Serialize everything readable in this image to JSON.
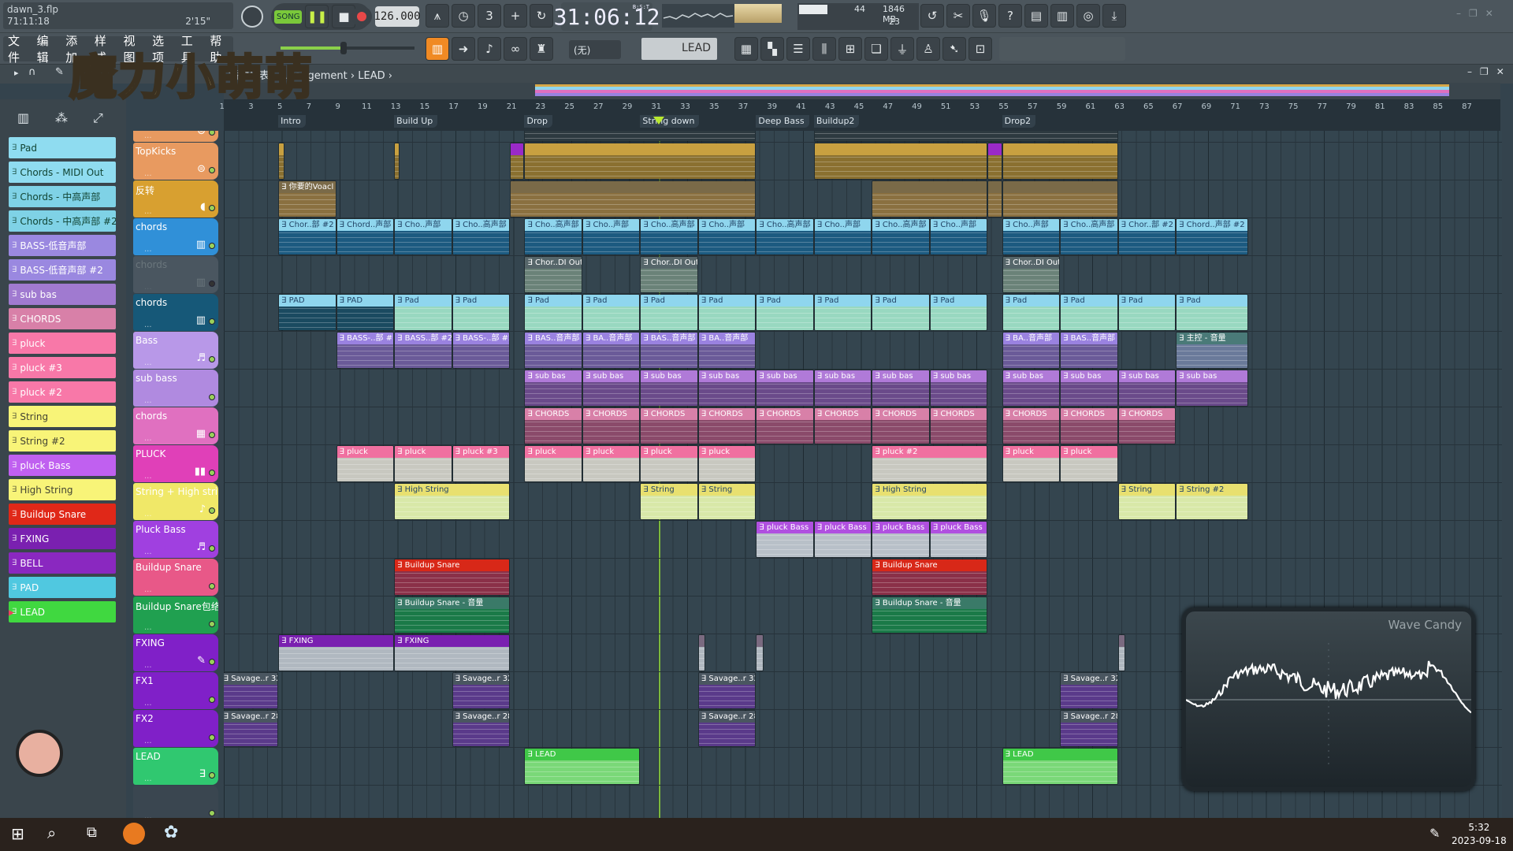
{
  "window": {
    "file": "dawn_3.flp",
    "position": "71:11:18",
    "length": "2'15\"",
    "watermark": "魔力小萌萌"
  },
  "menu": [
    "文件",
    "编辑",
    "添加",
    "样式",
    "视图",
    "选项",
    "工具",
    "帮助"
  ],
  "transport": {
    "mode": "SONG",
    "tempo": "126.000",
    "time": "31:06:12",
    "time_format": "B:S:T",
    "cpu": "44",
    "memory": "1846 MB",
    "polyphony": "23",
    "pattern_selector": "(无)",
    "current_pattern": "LEAD"
  },
  "breadcrumb": {
    "path": "播放列表 - Arrangement",
    "current": "LEAD"
  },
  "colors": {
    "accent": "#f08a24",
    "playhead": "#8fd63a"
  },
  "ruler": {
    "first_bar": 1,
    "last_bar": 87,
    "step": 2,
    "playhead_bar": 31.3
  },
  "markers": [
    {
      "label": "Intro",
      "bar": 5
    },
    {
      "label": "Build Up",
      "bar": 13
    },
    {
      "label": "Drop",
      "bar": 22
    },
    {
      "label": "String down",
      "bar": 30
    },
    {
      "label": "Deep Bass",
      "bar": 38
    },
    {
      "label": "Buildup2",
      "bar": 42
    },
    {
      "label": "Drop2",
      "bar": 55
    }
  ],
  "patterns": [
    {
      "label": "Pad",
      "color": "#8fdcf0",
      "text": "#143"
    },
    {
      "label": "Chords - MIDI Out",
      "color": "#8fdcf0",
      "text": "#143"
    },
    {
      "label": "Chords - 中高声部",
      "color": "#7fd2e6",
      "text": "#143"
    },
    {
      "label": "Chords - 中高声部 #2",
      "color": "#7fd2e6",
      "text": "#143"
    },
    {
      "label": "BASS-低音声部",
      "color": "#9a88e0",
      "text": "#fff"
    },
    {
      "label": "BASS-低音声部 #2",
      "color": "#9a88e0",
      "text": "#fff"
    },
    {
      "label": "sub bas",
      "color": "#a07ad0",
      "text": "#fff"
    },
    {
      "label": "CHORDS",
      "color": "#d880a8",
      "text": "#fff"
    },
    {
      "label": "pluck",
      "color": "#f878a8",
      "text": "#fff"
    },
    {
      "label": "pluck #3",
      "color": "#f878a8",
      "text": "#fff"
    },
    {
      "label": "pluck #2",
      "color": "#f878a8",
      "text": "#fff"
    },
    {
      "label": "String",
      "color": "#f8f478",
      "text": "#443"
    },
    {
      "label": "String #2",
      "color": "#f8f478",
      "text": "#443"
    },
    {
      "label": "pluck Bass",
      "color": "#c060f0",
      "text": "#fff"
    },
    {
      "label": "High String",
      "color": "#f8f478",
      "text": "#443"
    },
    {
      "label": "Buildup Snare",
      "color": "#e02818",
      "text": "#fff"
    },
    {
      "label": "FXING",
      "color": "#7a20b0",
      "text": "#fff"
    },
    {
      "label": "BELL",
      "color": "#8a28c0",
      "text": "#fff"
    },
    {
      "label": "PAD",
      "color": "#50c8e0",
      "text": "#fff"
    },
    {
      "label": "LEAD",
      "color": "#40d840",
      "text": "#fff",
      "selected": true
    }
  ],
  "tracks": [
    {
      "name": "",
      "color": "#e89a60",
      "icon": "drum-icon",
      "head": "#d8a848",
      "body": "#2d3a40",
      "clips": [
        {
          "s": 22,
          "l": 16,
          "t": ""
        },
        {
          "s": 42,
          "l": 21,
          "t": ""
        }
      ]
    },
    {
      "name": "TopKicks",
      "color": "#e89a60",
      "icon": "drum-icon",
      "head": "#c8a040",
      "body": "#8a7030",
      "clips": [
        {
          "s": 5,
          "l": 0.4,
          "t": ""
        },
        {
          "s": 13,
          "l": 0.4,
          "t": ""
        },
        {
          "s": 21,
          "l": 1,
          "t": "",
          "head": "#9a2ac8"
        },
        {
          "s": 22,
          "l": 16,
          "t": ""
        },
        {
          "s": 42,
          "l": 12,
          "t": ""
        },
        {
          "s": 54,
          "l": 1,
          "t": "",
          "head": "#9a2ac8"
        },
        {
          "s": 55,
          "l": 8,
          "t": ""
        }
      ]
    },
    {
      "name": "反转",
      "color": "#d8a030",
      "icon": "audio-icon",
      "head": "#7a6a48",
      "body": "#8a7040",
      "clips": [
        {
          "s": 5,
          "l": 4,
          "t": "你要的Voacl"
        },
        {
          "s": 21,
          "l": 17,
          "t": ""
        },
        {
          "s": 46,
          "l": 8,
          "t": ""
        },
        {
          "s": 54,
          "l": 1,
          "t": ""
        },
        {
          "s": 55,
          "l": 8,
          "t": ""
        }
      ]
    },
    {
      "name": "chords",
      "color": "#3090d8",
      "icon": "piano-icon",
      "head": "#8fd6ee",
      "body": "#1c5a80",
      "clips": [
        {
          "s": 5,
          "l": 4,
          "t": "Chor..部 #2"
        },
        {
          "s": 9,
          "l": 4,
          "t": "Chord..声部"
        },
        {
          "s": 13,
          "l": 4,
          "t": "Cho..声部"
        },
        {
          "s": 17,
          "l": 4,
          "t": "Cho..高声部"
        },
        {
          "s": 22,
          "l": 4,
          "t": "Cho..高声部"
        },
        {
          "s": 26,
          "l": 4,
          "t": "Cho..声部"
        },
        {
          "s": 30,
          "l": 4,
          "t": "Cho..高声部"
        },
        {
          "s": 34,
          "l": 4,
          "t": "Cho..声部"
        },
        {
          "s": 38,
          "l": 4,
          "t": "Cho..高声部"
        },
        {
          "s": 42,
          "l": 4,
          "t": "Cho..声部"
        },
        {
          "s": 46,
          "l": 4,
          "t": "Cho..高声部"
        },
        {
          "s": 50,
          "l": 4,
          "t": "Cho..声部"
        },
        {
          "s": 55,
          "l": 4,
          "t": "Cho..声部"
        },
        {
          "s": 59,
          "l": 4,
          "t": "Cho..高声部"
        },
        {
          "s": 63,
          "l": 4,
          "t": "Chor..部 #2"
        },
        {
          "s": 67,
          "l": 5,
          "t": "Chord..声部 #2"
        }
      ]
    },
    {
      "name": "chords",
      "color": "#4a5660",
      "icon": "piano-icon",
      "muted": true,
      "head": "#56666a",
      "body": "#6a8278",
      "clips": [
        {
          "s": 22,
          "l": 4,
          "t": "Chor..DI Out"
        },
        {
          "s": 30,
          "l": 4,
          "t": "Chor..DI Out"
        },
        {
          "s": 55,
          "l": 4,
          "t": "Chor..DI Out"
        }
      ]
    },
    {
      "name": "chords",
      "color": "#165878",
      "icon": "piano-icon",
      "head": "#8fd6ee",
      "body": "#98d8c0",
      "clips": [
        {
          "s": 5,
          "l": 4,
          "t": "PAD",
          "body": "#1a4a60"
        },
        {
          "s": 9,
          "l": 4,
          "t": "PAD",
          "body": "#1a4a60"
        },
        {
          "s": 13,
          "l": 4,
          "t": "Pad"
        },
        {
          "s": 17,
          "l": 4,
          "t": "Pad"
        },
        {
          "s": 22,
          "l": 4,
          "t": "Pad"
        },
        {
          "s": 26,
          "l": 4,
          "t": "Pad"
        },
        {
          "s": 30,
          "l": 4,
          "t": "Pad"
        },
        {
          "s": 34,
          "l": 4,
          "t": "Pad"
        },
        {
          "s": 38,
          "l": 4,
          "t": "Pad"
        },
        {
          "s": 42,
          "l": 4,
          "t": "Pad"
        },
        {
          "s": 46,
          "l": 4,
          "t": "Pad"
        },
        {
          "s": 50,
          "l": 4,
          "t": "Pad"
        },
        {
          "s": 55,
          "l": 4,
          "t": "Pad"
        },
        {
          "s": 59,
          "l": 4,
          "t": "Pad"
        },
        {
          "s": 63,
          "l": 4,
          "t": "Pad"
        },
        {
          "s": 67,
          "l": 5,
          "t": "Pad"
        }
      ]
    },
    {
      "name": "Bass",
      "color": "#b898e8",
      "icon": "guitar-icon",
      "head": "#9a82e0",
      "body": "#6a5a98",
      "clips": [
        {
          "s": 9,
          "l": 4,
          "t": "BASS-..部 #2"
        },
        {
          "s": 13,
          "l": 4,
          "t": "BASS..部 #2"
        },
        {
          "s": 17,
          "l": 4,
          "t": "BASS-..部 #2"
        },
        {
          "s": 22,
          "l": 4,
          "t": "BAS..音声部"
        },
        {
          "s": 26,
          "l": 4,
          "t": "BA..音声部"
        },
        {
          "s": 30,
          "l": 4,
          "t": "BAS..音声部"
        },
        {
          "s": 34,
          "l": 4,
          "t": "BA..音声部"
        },
        {
          "s": 55,
          "l": 4,
          "t": "BA..音声部"
        },
        {
          "s": 59,
          "l": 4,
          "t": "BAS..音声部"
        },
        {
          "s": 67,
          "l": 5,
          "t": "主控 - 音量",
          "head": "#4a7a78",
          "body": "#6a7a9a"
        }
      ]
    },
    {
      "name": "sub bass",
      "color": "#b08ae0",
      "icon": "",
      "head": "#b07ad8",
      "body": "#6a4a8a",
      "clips": [
        {
          "s": 22,
          "l": 4,
          "t": "sub bas"
        },
        {
          "s": 26,
          "l": 4,
          "t": "sub bas"
        },
        {
          "s": 30,
          "l": 4,
          "t": "sub bas"
        },
        {
          "s": 34,
          "l": 4,
          "t": "sub bas"
        },
        {
          "s": 38,
          "l": 4,
          "t": "sub bas"
        },
        {
          "s": 42,
          "l": 4,
          "t": "sub bas"
        },
        {
          "s": 46,
          "l": 4,
          "t": "sub bas"
        },
        {
          "s": 50,
          "l": 4,
          "t": "sub bas"
        },
        {
          "s": 55,
          "l": 4,
          "t": "sub bas"
        },
        {
          "s": 59,
          "l": 4,
          "t": "sub bas"
        },
        {
          "s": 63,
          "l": 4,
          "t": "sub bas"
        },
        {
          "s": 67,
          "l": 5,
          "t": "sub bas"
        }
      ]
    },
    {
      "name": "chords",
      "color": "#e070c0",
      "icon": "keys-icon",
      "head": "#d880a8",
      "body": "#8a4a6a",
      "clips": [
        {
          "s": 22,
          "l": 4,
          "t": "CHORDS"
        },
        {
          "s": 26,
          "l": 4,
          "t": "CHORDS"
        },
        {
          "s": 30,
          "l": 4,
          "t": "CHORDS"
        },
        {
          "s": 34,
          "l": 4,
          "t": "CHORDS"
        },
        {
          "s": 38,
          "l": 4,
          "t": "CHORDS"
        },
        {
          "s": 42,
          "l": 4,
          "t": "CHORDS"
        },
        {
          "s": 46,
          "l": 4,
          "t": "CHORDS"
        },
        {
          "s": 50,
          "l": 4,
          "t": "CHORDS"
        },
        {
          "s": 55,
          "l": 4,
          "t": "CHORDS"
        },
        {
          "s": 59,
          "l": 4,
          "t": "CHORDS"
        },
        {
          "s": 63,
          "l": 4,
          "t": "CHORDS"
        }
      ]
    },
    {
      "name": "PLUCK",
      "color": "#e040b8",
      "icon": "xylophone-icon",
      "head": "#f070a0",
      "body": "#c8c8c0",
      "clips": [
        {
          "s": 9,
          "l": 4,
          "t": "pluck"
        },
        {
          "s": 13,
          "l": 4,
          "t": "pluck"
        },
        {
          "s": 17,
          "l": 4,
          "t": "pluck #3"
        },
        {
          "s": 22,
          "l": 4,
          "t": "pluck"
        },
        {
          "s": 26,
          "l": 4,
          "t": "pluck"
        },
        {
          "s": 30,
          "l": 4,
          "t": "pluck"
        },
        {
          "s": 34,
          "l": 4,
          "t": "pluck"
        },
        {
          "s": 46,
          "l": 8,
          "t": "pluck #2"
        },
        {
          "s": 55,
          "l": 4,
          "t": "pluck"
        },
        {
          "s": 59,
          "l": 4,
          "t": "pluck"
        }
      ]
    },
    {
      "name": "String + High string",
      "color": "#f0e868",
      "icon": "violin-icon",
      "head": "#e8e070",
      "body": "#d8e8a8",
      "clips": [
        {
          "s": 13,
          "l": 8,
          "t": "High String"
        },
        {
          "s": 30,
          "l": 4,
          "t": "String"
        },
        {
          "s": 34,
          "l": 4,
          "t": "String"
        },
        {
          "s": 46,
          "l": 8,
          "t": "High String"
        },
        {
          "s": 63,
          "l": 4,
          "t": "String"
        },
        {
          "s": 67,
          "l": 5,
          "t": "String #2"
        }
      ]
    },
    {
      "name": "Pluck Bass",
      "color": "#a040e0",
      "icon": "guitar-icon",
      "head": "#b050e0",
      "body": "#b8c0c8",
      "clips": [
        {
          "s": 38,
          "l": 4,
          "t": "pluck Bass"
        },
        {
          "s": 42,
          "l": 4,
          "t": "pluck Bass"
        },
        {
          "s": 46,
          "l": 4,
          "t": "pluck Bass"
        },
        {
          "s": 50,
          "l": 4,
          "t": "pluck Bass"
        }
      ]
    },
    {
      "name": "Buildup Snare",
      "color": "#e85888",
      "icon": "",
      "head": "#d82818",
      "body": "#8a3048",
      "clips": [
        {
          "s": 13,
          "l": 8,
          "t": "Buildup Snare"
        },
        {
          "s": 46,
          "l": 8,
          "t": "Buildup Snare"
        }
      ]
    },
    {
      "name": "Buildup Snare包络",
      "color": "#20a050",
      "icon": "",
      "head": "#3a7a68",
      "body": "#1a7a48",
      "clips": [
        {
          "s": 13,
          "l": 8,
          "t": "Buildup Snare - 音量"
        },
        {
          "s": 46,
          "l": 8,
          "t": "Buildup Snare - 音量"
        }
      ]
    },
    {
      "name": "FXING",
      "color": "#8020c8",
      "icon": "pencil-icon",
      "head": "#7a20b0",
      "body": "#b0b8c0",
      "clips": [
        {
          "s": 5,
          "l": 8,
          "t": "FXING"
        },
        {
          "s": 13,
          "l": 8,
          "t": "FXING"
        },
        {
          "s": 34,
          "l": 0.5,
          "t": "",
          "head": "#7a6a80"
        },
        {
          "s": 38,
          "l": 0.5,
          "t": "",
          "head": "#7a6a80"
        },
        {
          "s": 63,
          "l": 0.5,
          "t": "",
          "head": "#7a6a80"
        }
      ]
    },
    {
      "name": "FX1",
      "color": "#8020c8",
      "icon": "",
      "head": "#4a5660",
      "body": "#5a3a8a",
      "clips": [
        {
          "s": 1,
          "l": 4,
          "t": "Savage..r 32"
        },
        {
          "s": 17,
          "l": 4,
          "t": "Savage..r 32"
        },
        {
          "s": 34,
          "l": 4,
          "t": "Savage..r 32"
        },
        {
          "s": 59,
          "l": 4,
          "t": "Savage..r 32"
        }
      ]
    },
    {
      "name": "FX2",
      "color": "#8020c8",
      "icon": "",
      "head": "#4a5660",
      "body": "#5a3a8a",
      "clips": [
        {
          "s": 1,
          "l": 4,
          "t": "Savage..r 28"
        },
        {
          "s": 17,
          "l": 4,
          "t": "Savage..r 28"
        },
        {
          "s": 34,
          "l": 4,
          "t": "Savage..r 28"
        },
        {
          "s": 59,
          "l": 4,
          "t": "Savage..r 28"
        }
      ]
    },
    {
      "name": "LEAD",
      "color": "#30c870",
      "icon": "pattern-icon",
      "head": "#40c848",
      "body": "#7ad878",
      "clips": [
        {
          "s": 22,
          "l": 8,
          "t": "LEAD"
        },
        {
          "s": 55,
          "l": 8,
          "t": "LEAD"
        }
      ]
    },
    {
      "name": "",
      "color": "#3a4650",
      "icon": "",
      "head": "#444",
      "body": "#444",
      "clips": []
    }
  ],
  "wave_candy": {
    "title": "Wave Candy"
  },
  "taskbar": {
    "time": "5:32",
    "date": "2023-09-18"
  }
}
